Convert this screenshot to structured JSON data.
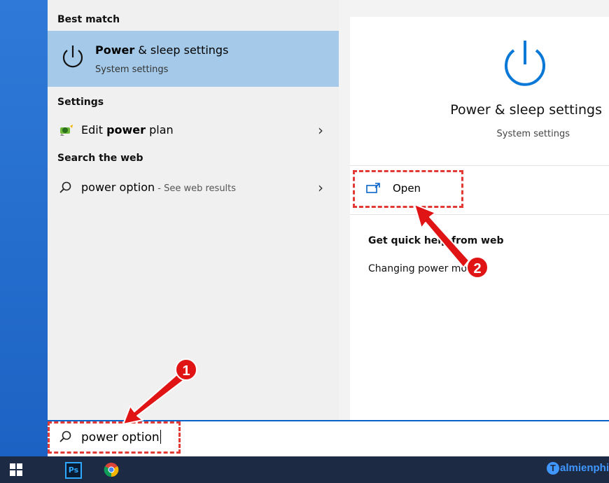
{
  "results": {
    "best_match_heading": "Best match",
    "best": {
      "title_bold": "Power",
      "title_rest": " & sleep settings",
      "subtitle": "System settings",
      "icon": "power-icon"
    },
    "settings_heading": "Settings",
    "settings_item": {
      "label_pre": "Edit ",
      "label_bold": "power",
      "label_post": " plan",
      "icon": "power-plan-icon"
    },
    "web_heading": "Search the web",
    "web_item": {
      "query": "power option",
      "suffix": " - See web results",
      "icon": "search-icon"
    }
  },
  "detail": {
    "title": "Power & sleep settings",
    "subtitle": "System settings",
    "open_label": "Open",
    "help_heading": "Get quick help from web",
    "help_link": "Changing power mode"
  },
  "search": {
    "value": "power option"
  },
  "annotations": {
    "badge1": "1",
    "badge2": "2"
  },
  "taskbar": {
    "ps_label": "Ps",
    "brand_letter": "T",
    "brand_text": "almienphi"
  },
  "colors": {
    "accent": "#0a64c8",
    "highlight": "#a5cae9",
    "annotation": "#e01414"
  }
}
